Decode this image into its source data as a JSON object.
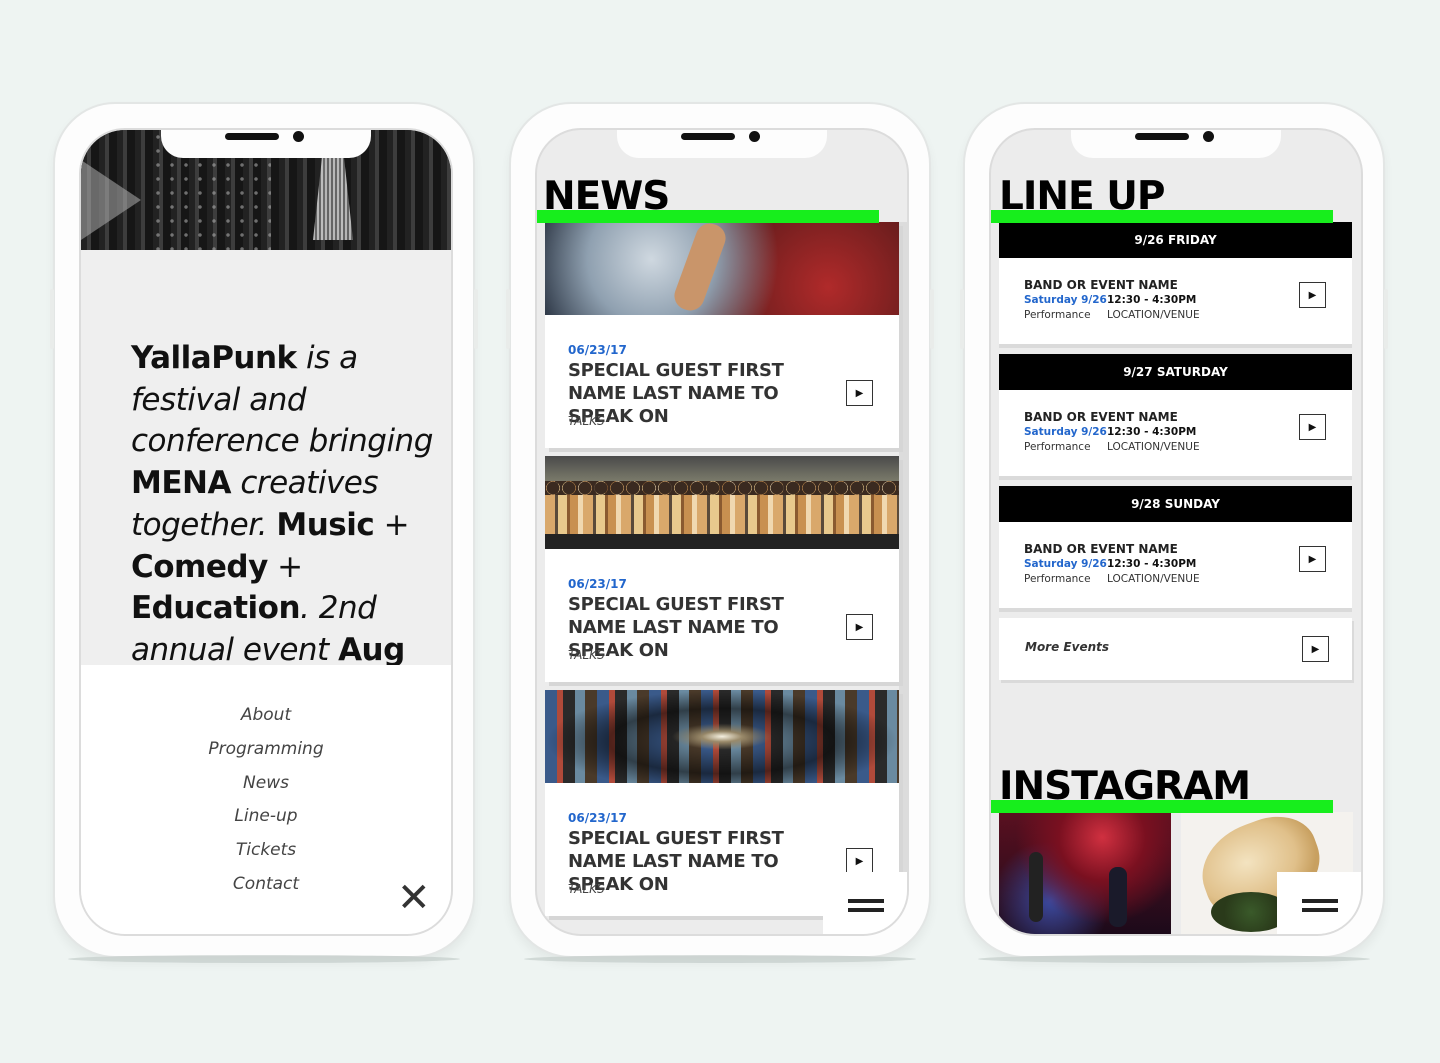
{
  "phone1": {
    "intro": {
      "brand": "YallaPunk",
      "t1": " is a festival and conference bringing ",
      "mena": "MENA",
      "t2": " creatives together. ",
      "music": "Music",
      "plus1": " + ",
      "comedy": "Comedy",
      "plus2": " + ",
      "education": "Education",
      "t3": ". 2nd annual event ",
      "aug": "Aug"
    },
    "menu": [
      "About",
      "Programming",
      "News",
      "Line-up",
      "Tickets",
      "Contact"
    ],
    "close_icon": "close-icon"
  },
  "phone2": {
    "title": "NEWS",
    "cards": [
      {
        "date": "06/23/17",
        "headline": "SPECIAL GUEST FIRST NAME LAST NAME TO SPEAK ON",
        "tag": "TALKS",
        "image": "concert-crowd-photo"
      },
      {
        "date": "06/23/17",
        "headline": "SPECIAL GUEST FIRST NAME LAST NAME TO SPEAK ON",
        "tag": "TALKS",
        "image": "group-portrait-photo"
      },
      {
        "date": "06/23/17",
        "headline": "SPECIAL GUEST FIRST NAME LAST NAME TO SPEAK ON",
        "tag": "TALKS",
        "image": "graffiti-tunnel-photo"
      }
    ]
  },
  "phone3": {
    "title": "LINE UP",
    "days": [
      {
        "label": "9/26 FRIDAY",
        "event": {
          "name": "BAND OR EVENT NAME",
          "date": "Saturday 9/26",
          "time": "12:30 - 4:30PM",
          "type": "Performance",
          "location": "LOCATION/VENUE"
        }
      },
      {
        "label": "9/27 SATURDAY",
        "event": {
          "name": "BAND OR EVENT NAME",
          "date": "Saturday 9/26",
          "time": "12:30 - 4:30PM",
          "type": "Performance",
          "location": "LOCATION/VENUE"
        }
      },
      {
        "label": "9/28 SUNDAY",
        "event": {
          "name": "BAND OR EVENT NAME",
          "date": "Saturday 9/26",
          "time": "12:30 - 4:30PM",
          "type": "Performance",
          "location": "LOCATION/VENUE"
        }
      }
    ],
    "more_label": "More Events",
    "instagram_title": "INSTAGRAM"
  },
  "colors": {
    "accent_green": "#17ee1c",
    "date_blue": "#2266cc",
    "black": "#000000"
  }
}
